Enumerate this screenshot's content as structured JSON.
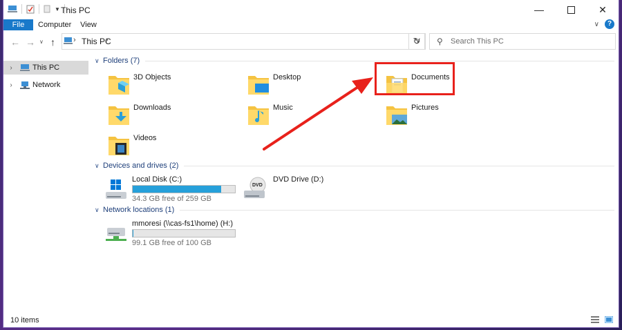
{
  "window": {
    "title": "This PC"
  },
  "ribbon": {
    "tabs": [
      "File",
      "Computer",
      "View"
    ]
  },
  "address": {
    "crumb": "This PC"
  },
  "search": {
    "placeholder": "Search This PC"
  },
  "sidebar": {
    "items": [
      {
        "label": "This PC"
      },
      {
        "label": "Network"
      }
    ]
  },
  "groups": {
    "folders": {
      "header": "Folders (7)",
      "items": [
        "3D Objects",
        "Desktop",
        "Documents",
        "Downloads",
        "Music",
        "Pictures",
        "Videos"
      ]
    },
    "drives": {
      "header": "Devices and drives (2)",
      "items": [
        {
          "name": "Local Disk (C:)",
          "free": "34.3 GB free of 259 GB",
          "used_fraction": 0.868
        },
        {
          "name": "DVD Drive (D:)"
        }
      ]
    },
    "network": {
      "header": "Network locations (1)",
      "items": [
        {
          "name": "mmoresi (\\\\cas-fs1\\home) (H:)",
          "free": "99.1 GB free of 100 GB",
          "used_fraction": 0.009
        }
      ]
    }
  },
  "dvd_label": "DVD",
  "status": {
    "count": "10 items"
  },
  "colors": {
    "accent": "#1979ca",
    "highlight": "#e8211b",
    "drivebar": "#26a0da",
    "group_header": "#1e3f7a"
  }
}
